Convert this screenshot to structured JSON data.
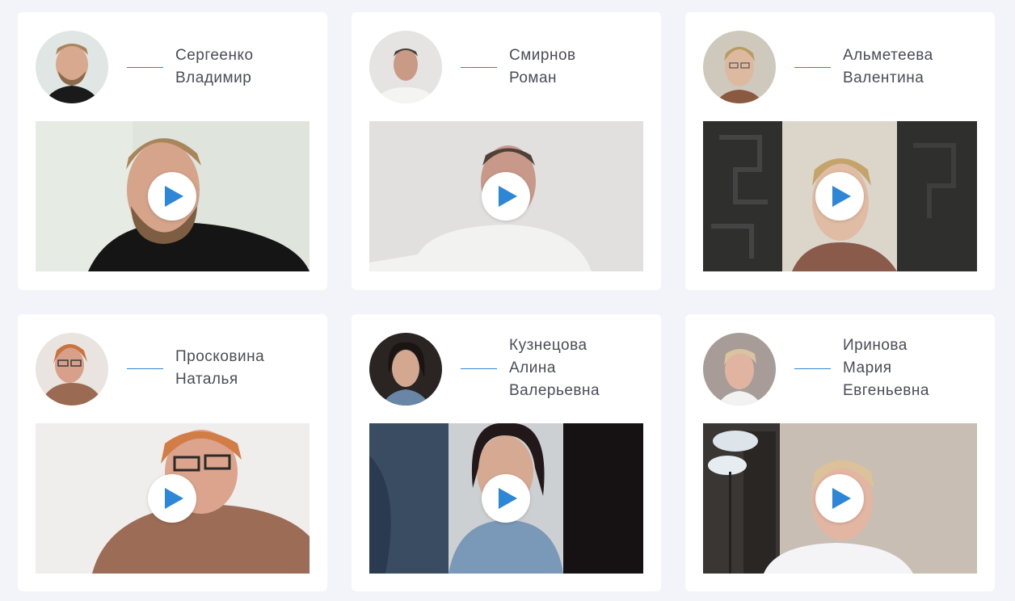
{
  "accent_color": "#2d86d6",
  "play_icon": "play-icon",
  "testimonials": [
    {
      "name_lines": [
        "Сергеенко",
        "Владимир"
      ]
    },
    {
      "name_lines": [
        "Смирнов",
        "Роман"
      ]
    },
    {
      "name_lines": [
        "Альметеева",
        "Валентина"
      ]
    },
    {
      "name_lines": [
        "Просковина",
        "Наталья"
      ]
    },
    {
      "name_lines": [
        "Кузнецова",
        "Алина",
        "Валерьевна"
      ]
    },
    {
      "name_lines": [
        "Иринова",
        "Мария",
        "Евгеньевна"
      ]
    }
  ]
}
